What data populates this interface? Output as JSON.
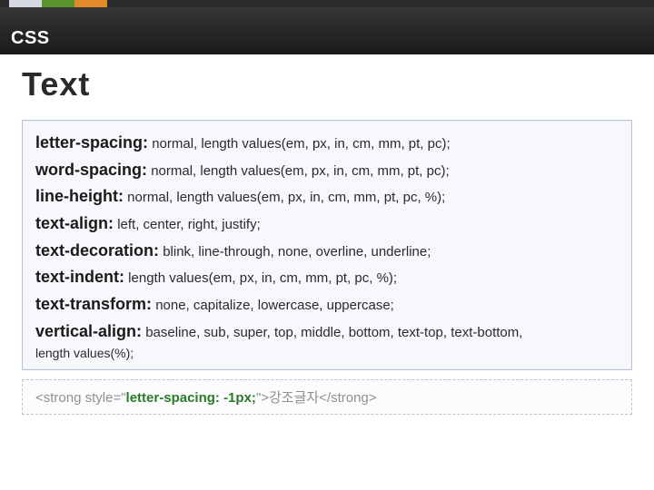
{
  "header": {
    "title": "CSS"
  },
  "main": {
    "title": "Text",
    "properties": [
      {
        "name": "letter-spacing:",
        "values": "normal, length values(em, px, in, cm, mm, pt, pc);"
      },
      {
        "name": "word-spacing:",
        "values": "normal, length values(em, px, in, cm, mm, pt, pc);"
      },
      {
        "name": "line-height:",
        "values": "normal, length values(em, px, in, cm, mm, pt, pc, %);"
      },
      {
        "name": "text-align:",
        "values": "left, center, right, justify;"
      },
      {
        "name": "text-decoration:",
        "values": "blink, line-through, none, overline, underline;"
      },
      {
        "name": "text-indent:",
        "values": "length values(em, px, in, cm, mm, pt, pc, %);"
      },
      {
        "name": "text-transform:",
        "values": "none, capitalize, lowercase, uppercase;"
      },
      {
        "name": "vertical-align:",
        "values": "baseline, sub, super, top, middle, bottom, text-top, text-bottom,"
      }
    ],
    "trailing": "length values(%);",
    "code": {
      "pre": "<strong style=\"",
      "highlight": "letter-spacing: -1px;",
      "post": "\">강조글자</strong>"
    }
  }
}
